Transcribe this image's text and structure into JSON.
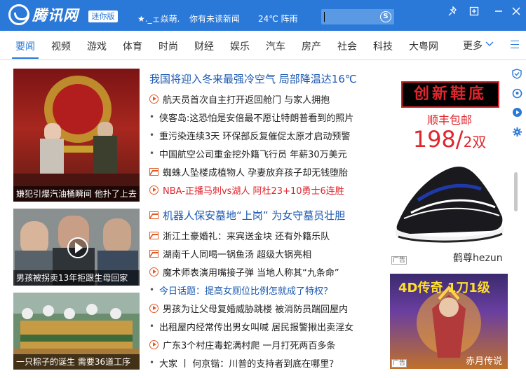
{
  "titlebar": {
    "logo_text": "腾讯网",
    "mini_badge": "迷你版",
    "user": "★._ェ焱萌.",
    "notification": "你有未读新闻",
    "weather": "24℃ 阵雨",
    "search_icon": "search-icon",
    "colors": {
      "bar": "#2a78d8",
      "accent": "#2a78d8"
    }
  },
  "nav": {
    "items": [
      "要闻",
      "视频",
      "游戏",
      "体育",
      "时尚",
      "财经",
      "娱乐",
      "汽车",
      "房产",
      "社会",
      "科技",
      "大粤网"
    ],
    "active_index": 0,
    "more": "更多"
  },
  "photos": [
    {
      "caption": "嫌犯引爆汽油桶瞬间 他扑了上去"
    },
    {
      "caption": "男孩被拐卖13年拒跟生母回家"
    },
    {
      "caption": "一只粽子的诞生 需要36道工序"
    }
  ],
  "news": [
    {
      "text": "我国将迎入冬来最强冷空气 局部降温达16℃",
      "icon": "none",
      "style": "headline"
    },
    {
      "text": "航天员首次自主打开返回舱门 与家人拥抱",
      "icon": "play",
      "style": "normal"
    },
    {
      "text": "侠客岛:这恐怕是安倍最不愿让特朗普看到的照片",
      "icon": "dot",
      "style": "normal"
    },
    {
      "text": "重污染连续3天 环保部反复催促太原才启动预警",
      "icon": "dot",
      "style": "normal"
    },
    {
      "text": "中国航空公司重金挖外籍飞行员 年薪30万美元",
      "icon": "dot",
      "style": "normal"
    },
    {
      "text": "蜘蛛人坠楼成植物人 孕妻放弃孩子却无钱堕胎",
      "icon": "pic",
      "style": "normal"
    },
    {
      "text": "NBA-正播马刺vs湖人 阿杜23+10勇士6连胜",
      "icon": "play",
      "style": "red"
    },
    {
      "text": "机器人保安墓地“上岗” 为女守墓员壮胆",
      "icon": "pic",
      "style": "headline"
    },
    {
      "text": "浙江土豪婚礼：来宾送金块 还有外籍乐队",
      "icon": "pic",
      "style": "normal"
    },
    {
      "text": "湖南千人同喝一锅鱼汤 超级大锅亮相",
      "icon": "pic",
      "style": "normal"
    },
    {
      "text": "魔术师表演用嘴接子弹 当地人称其“九条命”",
      "icon": "play",
      "style": "normal"
    },
    {
      "text": "今日话题：提高女厕位比例怎就成了特权？",
      "icon": "dot",
      "style": "blue"
    },
    {
      "text": "男孩为让父母复婚威胁跳楼 被消防员踹回屋内",
      "icon": "play",
      "style": "normal"
    },
    {
      "text": "出租屋内经常传出男女叫喊 居民报警揪出卖淫女",
      "icon": "dot",
      "style": "normal"
    },
    {
      "text": "广东3个村庄毒蛇满村爬 一月打死两百多条",
      "icon": "play",
      "style": "normal"
    },
    {
      "text": "大家 丨 何京锴：川普的支持者到底在哪里？",
      "icon": "dot",
      "style": "normal"
    }
  ],
  "ads": {
    "shoe": {
      "banner": "创新鞋底",
      "shipping": "顺丰包邮",
      "price": "198/",
      "unit": "2双",
      "tag": "广告",
      "brand": "鹤尊hezun"
    },
    "game": {
      "title": "4D传奇 1刀1级",
      "tag": "广告",
      "caption": "赤月传说"
    }
  },
  "sidebar_icons": [
    "shield-icon",
    "qq-icon",
    "video-play-icon",
    "gear-icon"
  ]
}
